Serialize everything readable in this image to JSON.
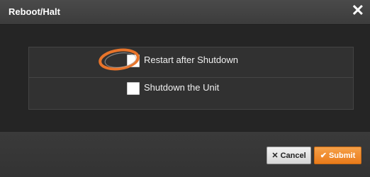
{
  "dialog": {
    "title": "Reboot/Halt",
    "close_icon": "close-icon"
  },
  "options": [
    {
      "label": "Restart after Shutdown",
      "checked": false
    },
    {
      "label": "Shutdown the Unit",
      "checked": false
    }
  ],
  "footer": {
    "cancel_label": "Cancel",
    "cancel_icon": "x-icon",
    "submit_label": "Submit",
    "submit_icon": "check-icon"
  },
  "colors": {
    "accent": "#ef8a2a",
    "highlight_ring": "#e8742a"
  }
}
